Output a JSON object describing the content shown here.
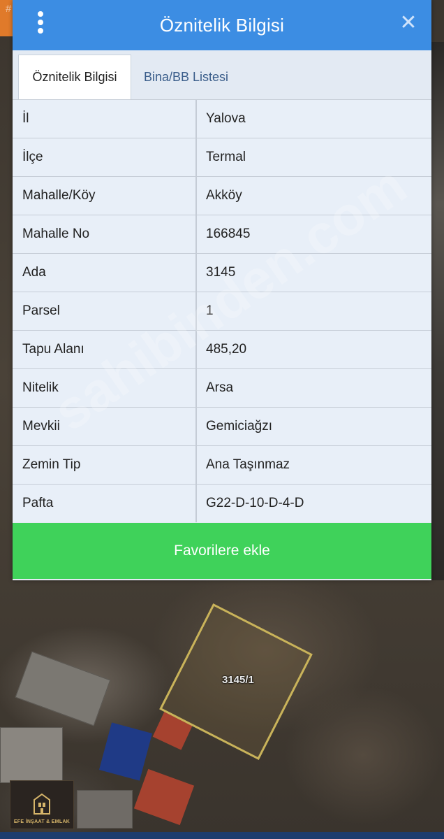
{
  "map": {
    "top_id": "#1291136692",
    "parcel_label": "3145/1",
    "logo_text": "EFE İNŞAAT & EMLAK",
    "colors": {
      "parcel_border": "#c9b35a",
      "accent_orange": "#e07a2a"
    }
  },
  "panel": {
    "title": "Öznitelik Bilgisi",
    "menu_icon": "more-vertical-icon",
    "close_icon": "close-icon",
    "close_glyph": "✕",
    "colors": {
      "header": "#3c8de3",
      "button": "#3fd25a",
      "row_bg": "#e8eff8"
    },
    "tabs": [
      {
        "label": "Öznitelik Bilgisi",
        "active": true
      },
      {
        "label": "Bina/BB Listesi",
        "active": false
      }
    ],
    "rows": [
      {
        "key": "İl",
        "value": "Yalova"
      },
      {
        "key": "İlçe",
        "value": "Termal"
      },
      {
        "key": "Mahalle/Köy",
        "value": "Akköy"
      },
      {
        "key": "Mahalle No",
        "value": "166845"
      },
      {
        "key": "Ada",
        "value": "3145"
      },
      {
        "key": "Parsel",
        "value": "1"
      },
      {
        "key": "Tapu Alanı",
        "value": "485,20"
      },
      {
        "key": "Nitelik",
        "value": "Arsa"
      },
      {
        "key": "Mevkii",
        "value": "Gemiciağzı"
      },
      {
        "key": "Zemin Tip",
        "value": "Ana Taşınmaz"
      },
      {
        "key": "Pafta",
        "value": "G22-D-10-D-4-D"
      }
    ],
    "favorite_button": "Favorilere ekle"
  },
  "watermark": "sahibinden.com"
}
